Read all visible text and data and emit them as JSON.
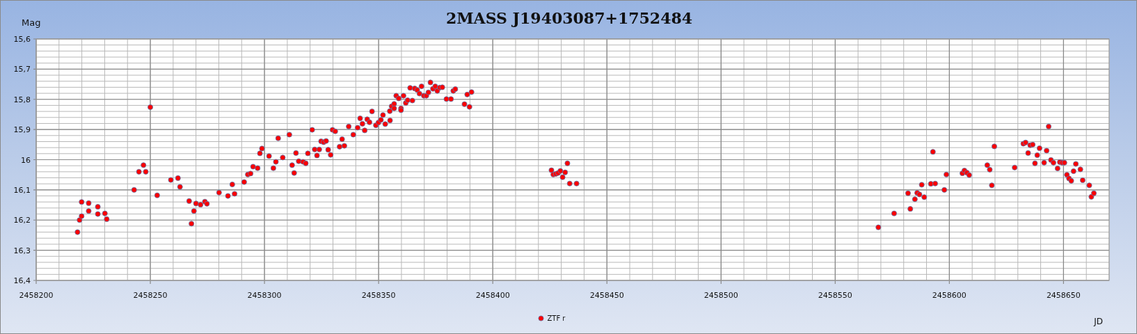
{
  "chart": {
    "chart_data": {
      "type": "scatter",
      "grid": true,
      "title": "2MASS J19403087+1752484",
      "xlabel": "JD",
      "ylabel": "Mag",
      "xlim": [
        2458200,
        2458670
      ],
      "ylim": [
        16.4,
        15.6
      ],
      "xticks": [
        2458200,
        2458250,
        2458300,
        2458350,
        2458400,
        2458450,
        2458500,
        2458550,
        2458600,
        2458650
      ],
      "yticks": [
        {
          "value": 15.6,
          "label": "15,6"
        },
        {
          "value": 15.7,
          "label": "15,7"
        },
        {
          "value": 15.8,
          "label": "15,8"
        },
        {
          "value": 15.9,
          "label": "15,9"
        },
        {
          "value": 16,
          "label": "16"
        },
        {
          "value": 16.1,
          "label": "16,1"
        },
        {
          "value": 16.2,
          "label": "16,2"
        },
        {
          "value": 16.3,
          "label": "16,3"
        },
        {
          "value": 16.4,
          "label": "16,4"
        }
      ],
      "x": [
        2458218.1,
        2458219.0,
        2458219.9,
        2458219.9,
        2458223.0,
        2458223.0,
        2458227.0,
        2458227.0,
        2458230.1,
        2458230.9,
        2458242.9,
        2458245.0,
        2458247.0,
        2458248.0,
        2458250.0,
        2458253.0,
        2458259.0,
        2458262.1,
        2458263.0,
        2458267.0,
        2458268.0,
        2458269.1,
        2458270.0,
        2458272.0,
        2458273.9,
        2458274.8,
        2458280.1,
        2458284.0,
        2458285.9,
        2458286.9,
        2458291.1,
        2458292.7,
        2458293.9,
        2458295.0,
        2458297.0,
        2458298.0,
        2458298.9,
        2458302.0,
        2458303.9,
        2458305.0,
        2458306.0,
        2458308.0,
        2458310.9,
        2458312.1,
        2458313.0,
        2458313.8,
        2458315.0,
        2458316.9,
        2458318.1,
        2458319.0,
        2458320.9,
        2458322.0,
        2458323.0,
        2458324.0,
        2458324.8,
        2458325.9,
        2458327.0,
        2458327.9,
        2458329.0,
        2458329.8,
        2458331.0,
        2458332.9,
        2458334.0,
        2458335.0,
        2458336.9,
        2458338.9,
        2458340.8,
        2458341.9,
        2458342.9,
        2458343.9,
        2458345.0,
        2458346.0,
        2458347.1,
        2458348.8,
        2458349.9,
        2458351.0,
        2458351.9,
        2458352.9,
        2458354.9,
        2458355.0,
        2458355.7,
        2458356.8,
        2458356.8,
        2458357.7,
        2458358.8,
        2458359.8,
        2458359.8,
        2458360.9,
        2458361.9,
        2458362.7,
        2458363.8,
        2458364.8,
        2458365.8,
        2458366.9,
        2458367.9,
        2458368.8,
        2458369.8,
        2458370.9,
        2458371.8,
        2458372.7,
        2458373.8,
        2458374.8,
        2458375.7,
        2458376.8,
        2458377.9,
        2458379.7,
        2458381.7,
        2458382.7,
        2458383.6,
        2458387.6,
        2458388.8,
        2458389.8,
        2458390.7,
        2458425.7,
        2458426.5,
        2458427.6,
        2458428.6,
        2458429.6,
        2458430.6,
        2458431.7,
        2458432.7,
        2458433.7,
        2458436.7,
        2458568.9,
        2458575.8,
        2458581.9,
        2458582.9,
        2458584.9,
        2458585.9,
        2458586.9,
        2458587.9,
        2458589.0,
        2458591.9,
        2458592.8,
        2458593.8,
        2458597.8,
        2458598.7,
        2458605.7,
        2458606.6,
        2458607.7,
        2458608.7,
        2458616.6,
        2458617.7,
        2458618.6,
        2458619.7,
        2458628.6,
        2458632.4,
        2458633.4,
        2458634.5,
        2458635.4,
        2458636.5,
        2458637.5,
        2458638.5,
        2458639.5,
        2458641.5,
        2458642.6,
        2458643.5,
        2458644.5,
        2458645.6,
        2458647.4,
        2458648.4,
        2458649.4,
        2458650.4,
        2458651.5,
        2458652.4,
        2458653.4,
        2458654.4,
        2458655.4,
        2458657.4,
        2458658.4,
        2458661.3,
        2458662.2,
        2458663.3
      ],
      "series": [
        {
          "name": "ZTF r",
          "color": "#ff0000",
          "values": [
            16.24,
            16.2,
            16.187,
            16.14,
            16.144,
            16.17,
            16.156,
            16.18,
            16.178,
            16.197,
            16.1,
            16.04,
            16.018,
            16.04,
            15.826,
            16.118,
            16.067,
            16.061,
            16.09,
            16.137,
            16.212,
            16.17,
            16.145,
            16.149,
            16.139,
            16.146,
            16.109,
            16.12,
            16.082,
            16.113,
            16.074,
            16.049,
            16.046,
            16.023,
            16.028,
            15.979,
            15.963,
            15.988,
            16.028,
            16.007,
            15.929,
            15.993,
            15.917,
            16.018,
            16.044,
            15.978,
            16.005,
            16.007,
            16.012,
            15.979,
            15.901,
            15.966,
            15.986,
            15.966,
            15.939,
            15.942,
            15.938,
            15.967,
            15.984,
            15.901,
            15.906,
            15.957,
            15.932,
            15.954,
            15.89,
            15.917,
            15.894,
            15.863,
            15.881,
            15.903,
            15.866,
            15.876,
            15.84,
            15.886,
            15.877,
            15.868,
            15.852,
            15.882,
            15.839,
            15.87,
            15.823,
            15.815,
            15.83,
            15.788,
            15.797,
            15.83,
            15.836,
            15.788,
            15.812,
            15.803,
            15.762,
            15.804,
            15.764,
            15.769,
            15.781,
            15.757,
            15.788,
            15.788,
            15.777,
            15.744,
            15.765,
            15.757,
            15.772,
            15.761,
            15.76,
            15.799,
            15.799,
            15.772,
            15.766,
            15.816,
            15.784,
            15.825,
            15.776,
            16.035,
            16.049,
            16.047,
            16.044,
            16.037,
            16.058,
            16.042,
            16.012,
            16.079,
            16.079,
            16.224,
            16.178,
            16.111,
            16.163,
            16.131,
            16.11,
            16.115,
            16.083,
            16.124,
            16.08,
            15.974,
            16.079,
            16.1,
            16.049,
            16.045,
            16.036,
            16.043,
            16.051,
            16.018,
            16.033,
            16.085,
            15.956,
            16.026,
            15.947,
            15.943,
            15.978,
            15.952,
            15.95,
            16.012,
            15.985,
            15.962,
            16.01,
            15.97,
            15.89,
            16.001,
            16.01,
            16.029,
            16.008,
            16.01,
            16.01,
            16.05,
            16.062,
            16.07,
            16.038,
            16.014,
            16.032,
            16.068,
            16.085,
            16.123,
            16.111
          ]
        }
      ]
    }
  }
}
